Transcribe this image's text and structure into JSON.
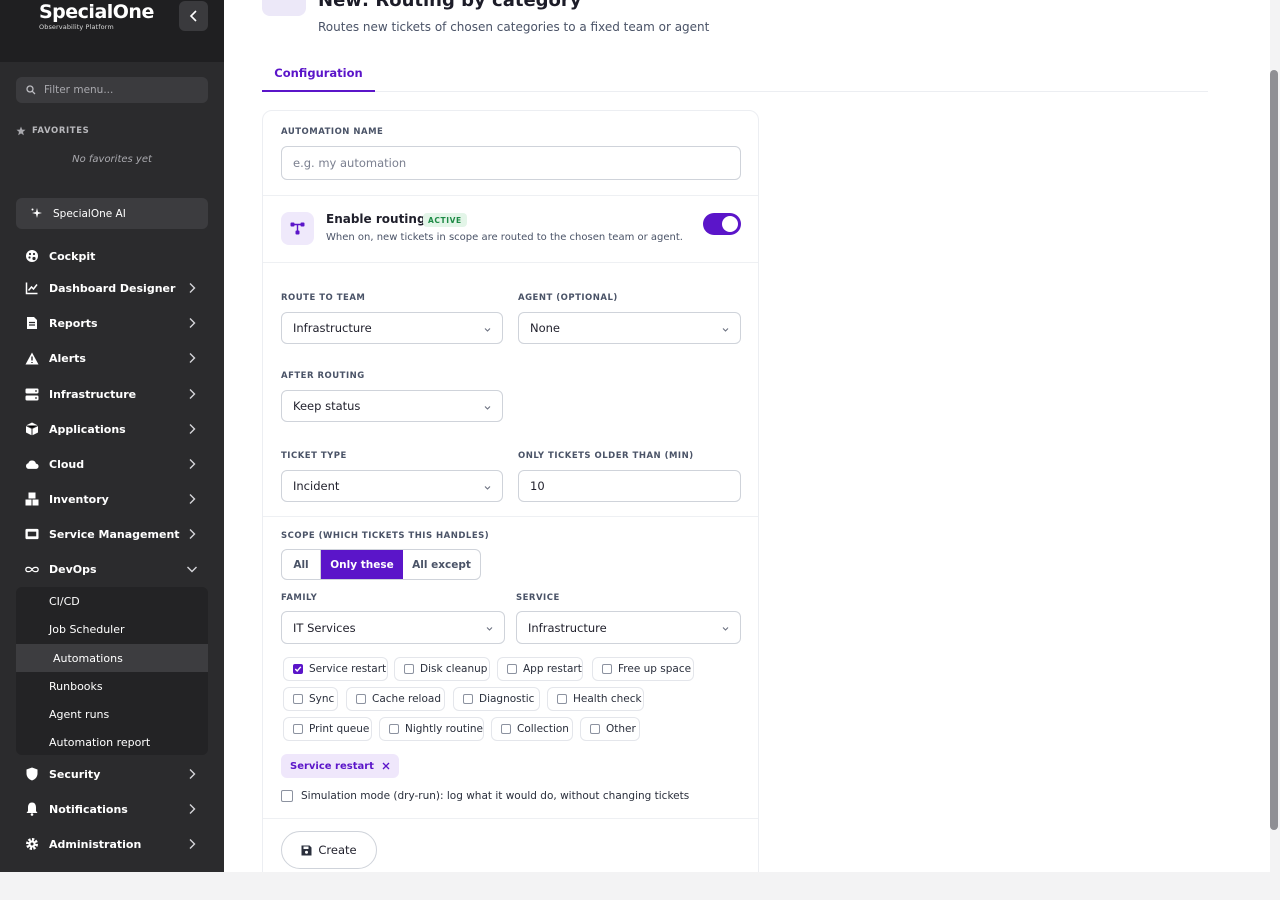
{
  "brand": {
    "name": "SpecialOne",
    "tagline": "Observability Platform"
  },
  "sidebar": {
    "filter_placeholder": "Filter menu...",
    "favorites_title": "FAVORITES",
    "favorites_empty": "No favorites yet",
    "ai_label": "SpecialOne AI",
    "items": [
      {
        "label": "Cockpit",
        "icon": "palette-icon"
      },
      {
        "label": "Dashboard Designer",
        "icon": "chart-line-icon"
      },
      {
        "label": "Reports",
        "icon": "document-icon"
      },
      {
        "label": "Alerts",
        "icon": "warning-icon"
      },
      {
        "label": "Infrastructure",
        "icon": "server-icon"
      },
      {
        "label": "Applications",
        "icon": "cube-icon"
      },
      {
        "label": "Cloud",
        "icon": "cloud-icon"
      },
      {
        "label": "Inventory",
        "icon": "boxes-icon"
      },
      {
        "label": "Service Management",
        "icon": "ticket-icon"
      },
      {
        "label": "DevOps",
        "icon": "infinity-icon"
      },
      {
        "label": "Security",
        "icon": "shield-icon"
      },
      {
        "label": "Notifications",
        "icon": "bell-icon"
      },
      {
        "label": "Administration",
        "icon": "gear-icon"
      }
    ],
    "devops_sub": [
      "CI/CD",
      "Job Scheduler",
      "Automations",
      "Runbooks",
      "Agent runs",
      "Automation report"
    ],
    "active_sub": "Automations"
  },
  "page": {
    "title": "New: Routing by category",
    "subtitle": "Routes new tickets of chosen categories to a fixed team or agent",
    "tab": "Configuration"
  },
  "form": {
    "name_label": "AUTOMATION NAME",
    "name_placeholder": "e.g. my automation",
    "routing_title": "Enable routing",
    "routing_badge": "ACTIVE",
    "routing_desc": "When on, new tickets in scope are routed to the chosen team or agent.",
    "routing_enabled": true,
    "team_label": "ROUTE TO TEAM",
    "team_value": "Infrastructure",
    "agent_label": "AGENT (OPTIONAL)",
    "agent_value": "None",
    "after_label": "AFTER ROUTING",
    "after_value": "Keep status",
    "type_label": "TICKET TYPE",
    "type_value": "Incident",
    "older_label": "ONLY TICKETS OLDER THAN (MIN)",
    "older_value": "10",
    "scope_label": "SCOPE (WHICH TICKETS THIS HANDLES)",
    "scope_options": [
      "All",
      "Only these",
      "All except"
    ],
    "scope_selected": "Only these",
    "family_label": "FAMILY",
    "family_value": "IT Services",
    "service_label": "SERVICE",
    "service_value": "Infrastructure",
    "categories": [
      "Service restart",
      "Disk cleanup",
      "App restart",
      "Free up space",
      "Sync",
      "Cache reload",
      "Diagnostic",
      "Health check",
      "Print queue",
      "Nightly routine",
      "Collection",
      "Other"
    ],
    "checked": [
      "Service restart"
    ],
    "chip": "Service restart",
    "dry_run": "Simulation mode (dry-run): log what it would do, without changing tickets",
    "create_label": "Create"
  },
  "colors": {
    "accent": "#5b15c9",
    "sidebar_bg": "#2b2b2d",
    "badge_green": "#1d8a45"
  }
}
